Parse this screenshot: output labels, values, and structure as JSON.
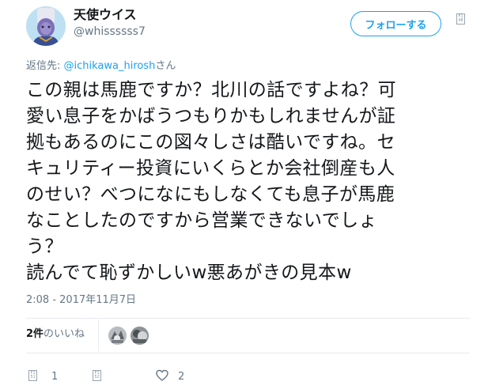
{
  "user": {
    "display_name": "天使ウイス",
    "screen_name": "@whissssss7"
  },
  "follow_button": {
    "label": "フォローする"
  },
  "more_icon": {
    "glyph_top": "F1",
    "glyph_bottom": "4B"
  },
  "reply_context": {
    "prefix": "返信先: ",
    "mention": "@ichikawa_hirosh",
    "suffix": "さん"
  },
  "tweet": {
    "lines": [
      "この親は馬鹿ですか？北川の話ですよね？可",
      "愛い息子をかばうつもりかもしれませんが証",
      "拠もあるのにこの図々しさは酷いですね。セ",
      "キュリティー投資にいくらとか会社倒産も人",
      "のせい？べつになにもしなくても息子が馬鹿",
      "なことしたのですから営業できないでしょ",
      "う？",
      "読んでて恥ずかしいw悪あがきの見本w"
    ]
  },
  "timestamp": "2:08 - 2017年11月7日",
  "likes": {
    "count": "2件",
    "label": "のいいね"
  },
  "actions": {
    "reply": {
      "count": "1",
      "glyph_top": "F1",
      "glyph_bottom": "51"
    },
    "retweet": {
      "glyph_top": "F1",
      "glyph_bottom": "52"
    },
    "like": {
      "count": "2"
    }
  },
  "icons": {
    "avatar": "avatar",
    "more": "caret-down-icon",
    "reply": "reply-icon",
    "retweet": "retweet-icon",
    "like": "heart-icon"
  },
  "colors": {
    "accent": "#1da1f2",
    "text": "#14171a",
    "secondary_text": "#657786",
    "divider": "#e6ecf0"
  }
}
